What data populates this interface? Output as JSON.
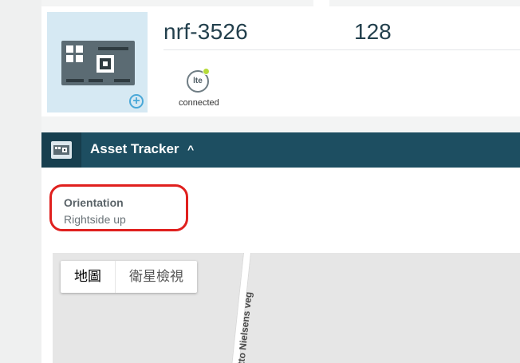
{
  "device": {
    "name": "nrf-3526",
    "number": "128",
    "network_icon_text": "lte",
    "network_status": "connected",
    "thumb_icon": "circuit-board-icon",
    "add_icon": "plus-circle-icon",
    "status_dot_color": "#b5db3a"
  },
  "tracker": {
    "title": "Asset Tracker",
    "chevron": "^",
    "icon": "asset-tracker-icon",
    "bar_color": "#1d4e61"
  },
  "orientation": {
    "label": "Orientation",
    "value": "Rightside up",
    "highlight_color": "#e0201e"
  },
  "map": {
    "type_buttons": [
      "地圖",
      "衛星檢視"
    ],
    "road_label": "Otto Nielsens veg"
  }
}
